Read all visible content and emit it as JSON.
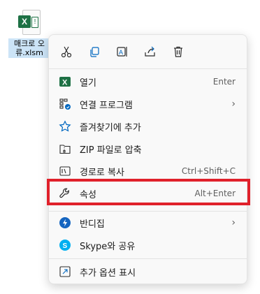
{
  "desktop": {
    "file_name": "매크로 오류.xlsm",
    "icon": "excel-macro-file-icon",
    "badge_letter": "X",
    "badge_mark": "!"
  },
  "toolbar": {
    "buttons": [
      {
        "name": "cut",
        "icon": "scissors-icon"
      },
      {
        "name": "copy",
        "icon": "copy-icon"
      },
      {
        "name": "rename",
        "icon": "rename-icon"
      },
      {
        "name": "share",
        "icon": "share-icon"
      },
      {
        "name": "delete",
        "icon": "trash-icon"
      }
    ]
  },
  "menu": {
    "open": {
      "label": "열기",
      "shortcut": "Enter",
      "icon": "excel-icon"
    },
    "open_with": {
      "label": "연결 프로그램",
      "icon": "apps-icon"
    },
    "favorites": {
      "label": "즐겨찾기에 추가",
      "icon": "star-icon"
    },
    "zip": {
      "label": "ZIP 파일로 압축",
      "icon": "zip-folder-icon"
    },
    "copy_path": {
      "label": "경로로 복사",
      "shortcut": "Ctrl+Shift+C",
      "icon": "path-icon"
    },
    "properties": {
      "label": "속성",
      "shortcut": "Alt+Enter",
      "icon": "wrench-icon"
    },
    "bandizip": {
      "label": "반디집",
      "icon": "bandizip-icon"
    },
    "skype": {
      "label": "Skype와 공유",
      "icon": "skype-icon"
    },
    "more": {
      "label": "추가 옵션 표시",
      "icon": "more-options-icon"
    }
  },
  "colors": {
    "highlight": "#e0212b",
    "excel_green": "#1e7145",
    "accent_blue": "#0067c0"
  }
}
